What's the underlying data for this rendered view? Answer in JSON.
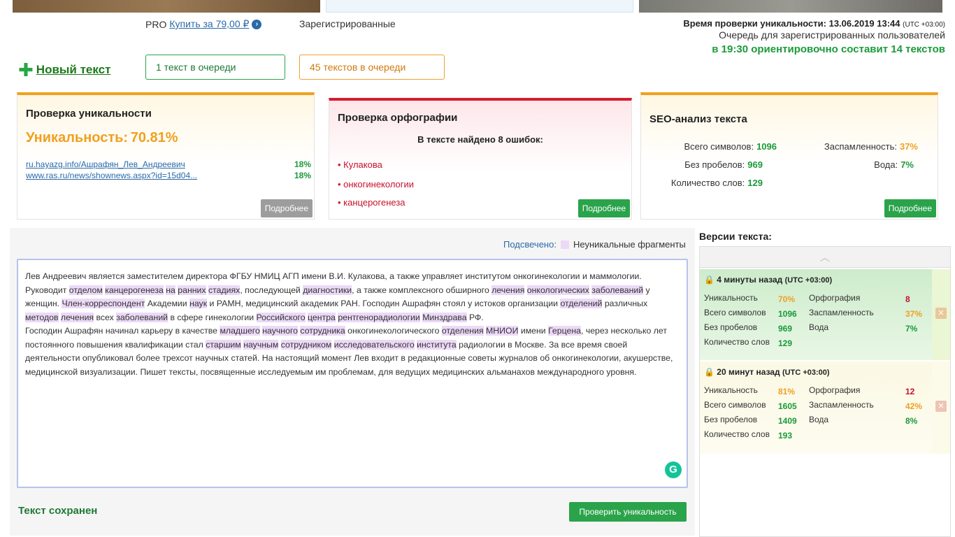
{
  "header": {
    "new_text": "Новый текст",
    "pro_label": "PRO",
    "buy_link": "Купить за 79,00 ₽",
    "registered_label": "Зарегистрированные",
    "queue_pro": "1 текст в очереди",
    "queue_registered": "45 текстов в очереди",
    "check_time_label": "Время проверки уникальности: 13.06.2019 13:44",
    "check_time_tz": "(UTC +03:00)",
    "queue_info": "Очередь для зарегистрированных пользователей",
    "queue_estimate": "в 19:30 ориентировочно составит 14 текстов"
  },
  "uniqueness_card": {
    "title": "Проверка уникальности",
    "uniq_label": "Уникальность:",
    "uniq_value": "70.81%",
    "sources": [
      {
        "url": "ru.hayazg.info/Ашрафян_Лев_Андреевич",
        "percent": "18%"
      },
      {
        "url": "www.ras.ru/news/shownews.aspx?id=15d04...",
        "percent": "18%"
      }
    ],
    "more_label": "Подробнее"
  },
  "spelling_card": {
    "title": "Проверка орфографии",
    "found": "В тексте найдено 8 ошибок:",
    "errors": [
      "• Кулакова",
      "• онкогинекологии",
      "• канцерогенеза"
    ],
    "more_label": "Подробнее"
  },
  "seo_card": {
    "title": "SEO-анализ текста",
    "total_chars_label": "Всего символов:",
    "total_chars": "1096",
    "no_spaces_label": "Без пробелов:",
    "no_spaces": "969",
    "words_label": "Количество слов:",
    "words": "129",
    "spam_label": "Заспамленность:",
    "spam": "37%",
    "water_label": "Вода:",
    "water": "7%",
    "more_label": "Подробнее"
  },
  "editor": {
    "highlight_label": "Подсвечено:",
    "highlight_desc": "Неуникальные фрагменты",
    "saved": "Текст сохранен",
    "check_button": "Проверить уникальность",
    "grammarly_letter": "G"
  },
  "versions": {
    "title": "Версии текста:",
    "items": [
      {
        "time": "4 минуты назад",
        "tz": "(UTC +03:00)",
        "uniq_label": "Уникальность",
        "uniq": "70%",
        "spell_label": "Орфография",
        "spell": "8",
        "chars_label": "Всего символов",
        "chars": "1096",
        "spam_label": "Заспамленность",
        "spam": "37%",
        "nospace_label": "Без пробелов",
        "nospace": "969",
        "water_label": "Вода",
        "water": "7%",
        "words_label": "Количество слов",
        "words": "129"
      },
      {
        "time": "20 минут назад",
        "tz": "(UTC +03:00)",
        "uniq_label": "Уникальность",
        "uniq": "81%",
        "spell_label": "Орфография",
        "spell": "12",
        "chars_label": "Всего символов",
        "chars": "1605",
        "spam_label": "Заспамленность",
        "spam": "42%",
        "nospace_label": "Без пробелов",
        "nospace": "1409",
        "water_label": "Вода",
        "water": "8%",
        "words_label": "Количество слов",
        "words": "193"
      }
    ]
  },
  "colors": {
    "green": "#2aa34a",
    "orange": "#f0a020",
    "red": "#c8102e",
    "link": "#2a6aa8",
    "highlight": "#ecd9f7"
  }
}
